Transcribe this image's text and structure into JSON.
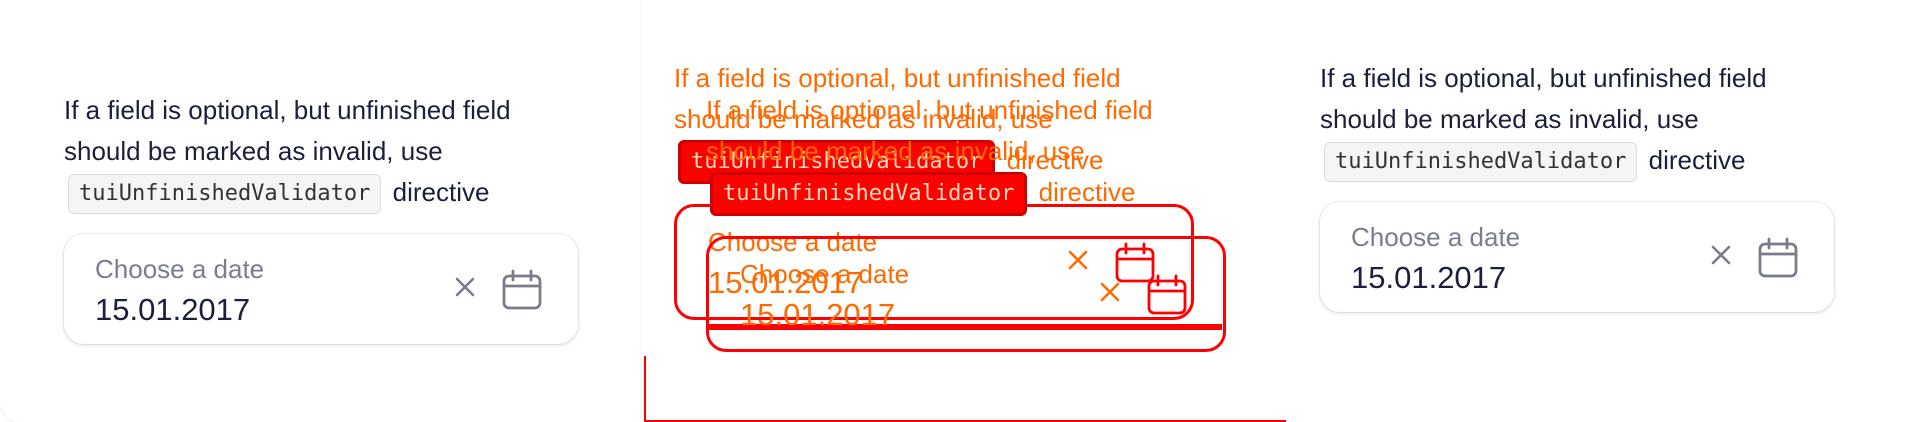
{
  "examples": [
    {
      "description_prefix": "If a field is optional, but unfinished field should be marked as invalid, use",
      "code": "tuiUnfinishedValidator",
      "description_suffix": "directive",
      "field": {
        "label": "Choose a date",
        "value": "15.01.2017",
        "clear_icon": "close-icon",
        "calendar_icon": "calendar-icon"
      }
    },
    {
      "description_prefix": "If a field is optional, but unfinished field should be marked as invalid, use",
      "code": "tuiUnfinishedValidator",
      "description_suffix": "directive",
      "field": {
        "label": "Choose a date",
        "value": "15.01.2017",
        "clear_icon": "close-icon",
        "calendar_icon": "calendar-icon"
      }
    },
    {
      "description_prefix": "If a field is optional, but unfinished field should be marked as invalid, use",
      "code": "tuiUnfinishedValidator",
      "description_suffix": "directive",
      "field": {
        "label": "Choose a date",
        "value": "15.01.2017",
        "clear_icon": "close-icon",
        "calendar_icon": "calendar-icon"
      }
    },
    {
      "description_prefix": "If a field is optional, but unfinished field should be marked as invalid, use",
      "code": "tuiUnfinishedValidator",
      "description_suffix": "directive",
      "field": {
        "label": "Choose a date",
        "value": "15.01.2017",
        "clear_icon": "close-icon",
        "calendar_icon": "calendar-icon"
      }
    }
  ],
  "colors": {
    "text": "#1b1f3b",
    "label": "#7a7d8c",
    "overlay_red": "#ff0000",
    "overlay_orange": "#ff6a00"
  }
}
